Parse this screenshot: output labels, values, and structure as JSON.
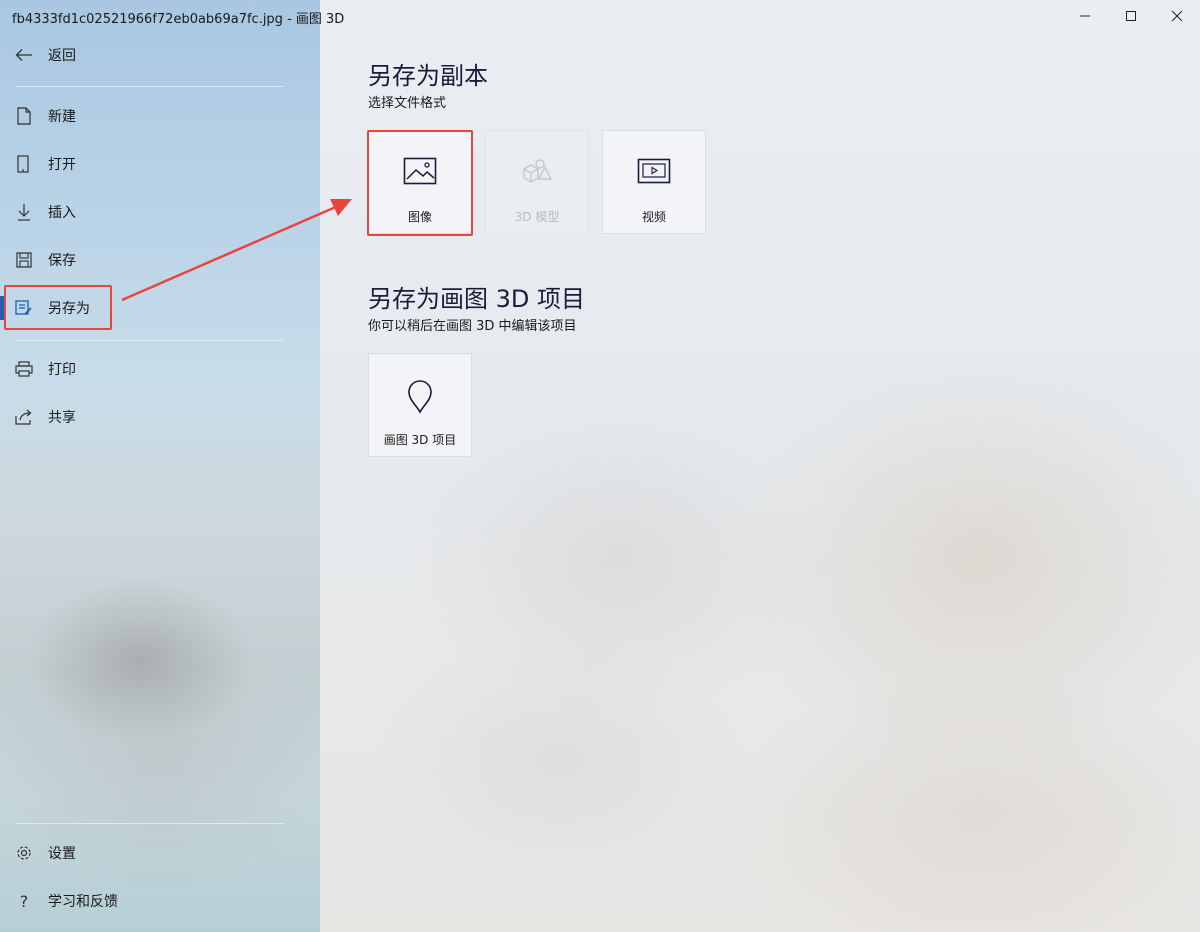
{
  "window": {
    "title": "fb4333fd1c02521966f72eb0ab69a7fc.jpg - 画图 3D"
  },
  "sidebar": {
    "back_label": "返回",
    "items": [
      {
        "label": "新建",
        "icon": "new-file-icon"
      },
      {
        "label": "打开",
        "icon": "open-icon"
      },
      {
        "label": "插入",
        "icon": "insert-icon"
      },
      {
        "label": "保存",
        "icon": "save-icon"
      },
      {
        "label": "另存为",
        "icon": "save-as-icon",
        "active": true
      },
      {
        "label": "打印",
        "icon": "print-icon"
      },
      {
        "label": "共享",
        "icon": "share-icon"
      }
    ],
    "bottom_items": [
      {
        "label": "设置",
        "icon": "gear-icon"
      },
      {
        "label": "学习和反馈",
        "icon": "help-icon"
      }
    ]
  },
  "main": {
    "copy_section": {
      "title": "另存为副本",
      "subtitle": "选择文件格式",
      "tiles": [
        {
          "label": "图像",
          "icon": "image-icon",
          "enabled": true,
          "highlighted": true
        },
        {
          "label": "3D 模型",
          "icon": "3d-model-icon",
          "enabled": false
        },
        {
          "label": "视频",
          "icon": "video-icon",
          "enabled": true
        }
      ]
    },
    "project_section": {
      "title": "另存为画图 3D 项目",
      "subtitle": "你可以稍后在画图 3D 中编辑该项目",
      "tiles": [
        {
          "label": "画图 3D 项目",
          "icon": "paint3d-project-icon",
          "enabled": true
        }
      ]
    }
  },
  "colors": {
    "accent": "#1e5fb3",
    "callout": "#e8453c",
    "heading": "#1c1c3a"
  }
}
